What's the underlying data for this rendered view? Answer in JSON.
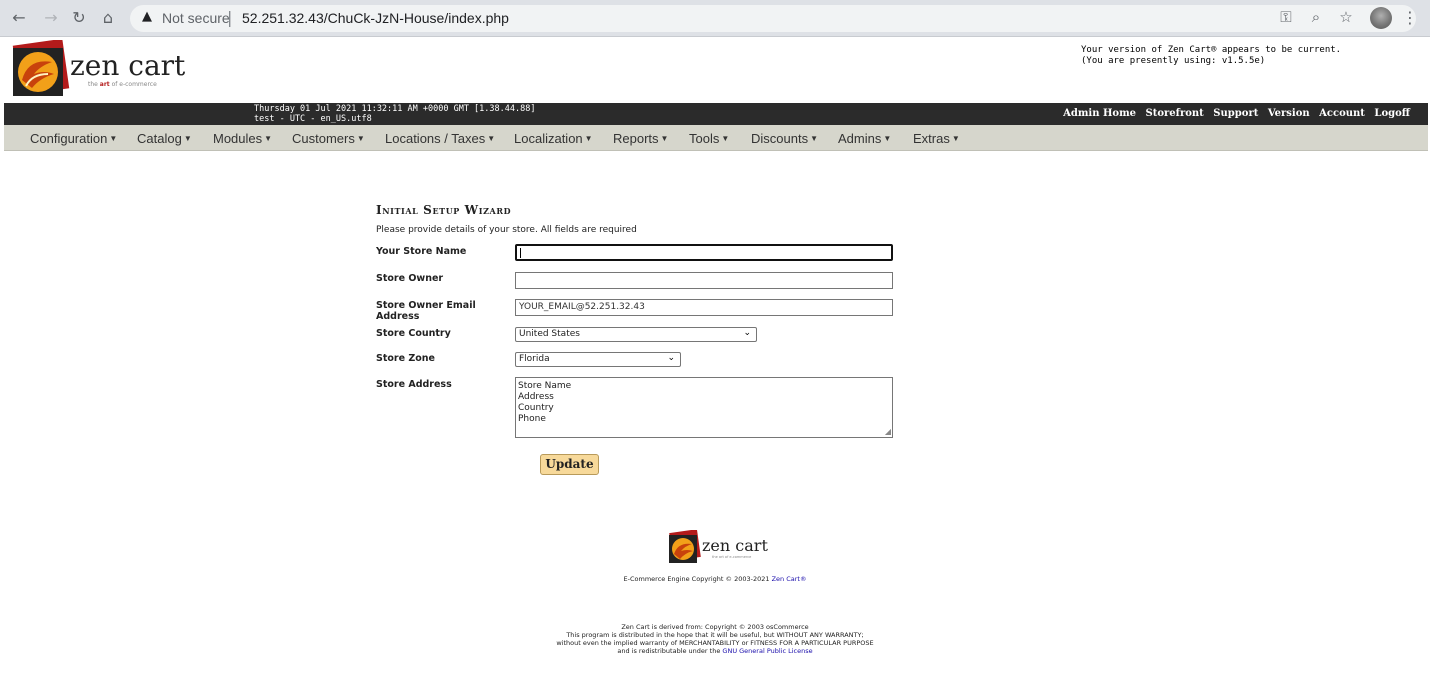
{
  "browser": {
    "warning_icon": "warning-triangle-icon",
    "not_secure": "Not secure",
    "separator": "|",
    "url": "52.251.32.43/ChuCk-JzN-House/index.php"
  },
  "header": {
    "logo_text": "zen cart",
    "logo_tagline_pre": "the",
    "logo_tagline_art": "art",
    "logo_tagline_post": "of e-commerce",
    "version_line1": "Your version of Zen Cart® appears to be current.",
    "version_line2": "(You are presently using: v1.5.5e)",
    "datetime_line1": "Thursday 01 Jul 2021 11:32:11 AM +0000 GMT [1.38.44.88]",
    "datetime_line2": "test - UTC - en_US.utf8"
  },
  "admin_links": [
    "Admin Home",
    "Storefront",
    "Support",
    "Version",
    "Account",
    "Logoff"
  ],
  "menu": [
    "Configuration",
    "Catalog",
    "Modules",
    "Customers",
    "Locations / Taxes",
    "Localization",
    "Reports",
    "Tools",
    "Discounts",
    "Admins",
    "Extras"
  ],
  "wizard": {
    "title": "Initial Setup Wizard",
    "description": "Please provide details of your store. All fields are required",
    "store_name_label": "Your Store Name",
    "store_name_value": "",
    "store_owner_label": "Store Owner",
    "store_owner_value": "",
    "owner_email_label": "Store Owner Email Address",
    "owner_email_value": "YOUR_EMAIL@52.251.32.43",
    "country_label": "Store Country",
    "country_value": "United States",
    "zone_label": "Store Zone",
    "zone_value": "Florida",
    "address_label": "Store Address",
    "address_lines": [
      "Store Name",
      "Address",
      "Country",
      "Phone"
    ],
    "update_label": "Update"
  },
  "footer": {
    "copyright_text": "E-Commerce Engine Copyright © 2003-2021",
    "copyright_link": "Zen Cart®",
    "license_line1": "Zen Cart is derived from: Copyright © 2003 osCommerce",
    "license_line2": "This program is distributed in the hope that it will be useful, but WITHOUT ANY WARRANTY;",
    "license_line3": "without even the implied warranty of MERCHANTABILITY or FITNESS FOR A PARTICULAR PURPOSE",
    "license_line4": "and is redistributable under the",
    "license_link": "GNU General Public License"
  },
  "colors": {
    "header_bar": "#2b2b2b",
    "menu_bar": "#d6d6cc",
    "update_button": "#f7d99a"
  }
}
